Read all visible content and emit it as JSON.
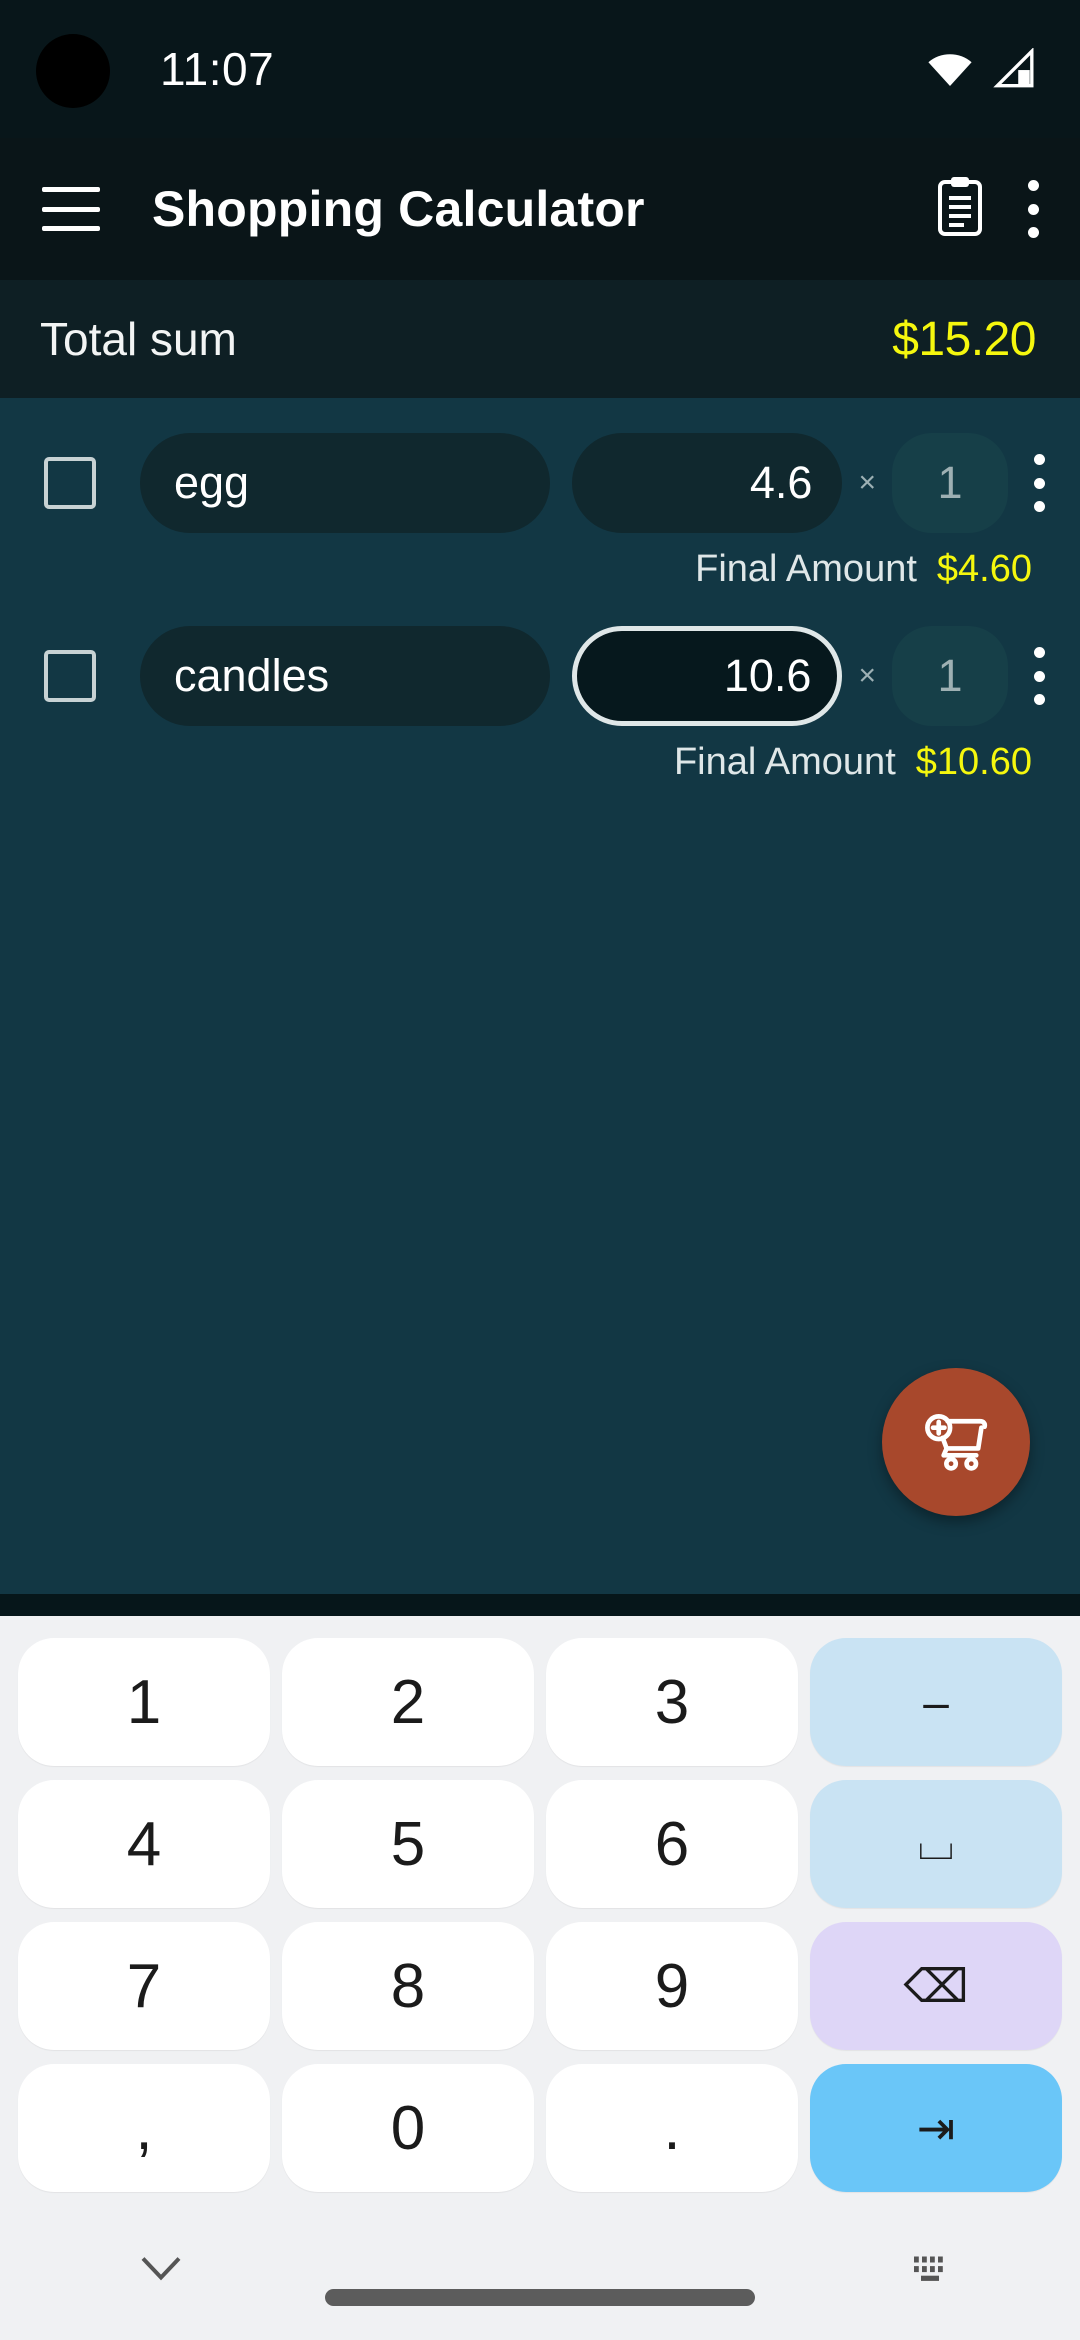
{
  "status_bar": {
    "time": "11:07",
    "wifi_icon": "wifi-icon",
    "signal_icon": "cellular-signal-icon"
  },
  "app_bar": {
    "menu_icon": "hamburger-menu-icon",
    "title": "Shopping Calculator",
    "list_icon": "clipboard-list-icon",
    "overflow_icon": "more-vertical-icon"
  },
  "total": {
    "label": "Total sum",
    "value": "$15.20",
    "value_color": "#f5f70e"
  },
  "items": [
    {
      "checked": false,
      "name": "egg",
      "price": "4.6",
      "multiply_symbol": "×",
      "quantity": "1",
      "final_label": "Final Amount",
      "final_value": "$4.60",
      "focused": false
    },
    {
      "checked": false,
      "name": "candles",
      "price": "10.6",
      "multiply_symbol": "×",
      "quantity": "1",
      "final_label": "Final Amount",
      "final_value": "$10.60",
      "focused": true
    }
  ],
  "fab": {
    "icon": "add-to-cart-icon",
    "color": "#a8482c"
  },
  "keyboard": {
    "rows": [
      [
        {
          "label": "1",
          "kind": "digit"
        },
        {
          "label": "2",
          "kind": "digit"
        },
        {
          "label": "3",
          "kind": "digit"
        },
        {
          "label": "–",
          "kind": "fn-blue",
          "name": "minus-key"
        }
      ],
      [
        {
          "label": "4",
          "kind": "digit"
        },
        {
          "label": "5",
          "kind": "digit"
        },
        {
          "label": "6",
          "kind": "digit"
        },
        {
          "label": "⌴",
          "kind": "fn-blue",
          "name": "space-key"
        }
      ],
      [
        {
          "label": "7",
          "kind": "digit"
        },
        {
          "label": "8",
          "kind": "digit"
        },
        {
          "label": "9",
          "kind": "digit"
        },
        {
          "label": "⌫",
          "kind": "fn-lilac",
          "name": "backspace-key"
        }
      ],
      [
        {
          "label": ",",
          "kind": "digit"
        },
        {
          "label": "0",
          "kind": "digit"
        },
        {
          "label": ".",
          "kind": "digit"
        },
        {
          "label": "⇥",
          "kind": "fn-enter",
          "name": "next-field-key"
        }
      ]
    ]
  },
  "nav_bar": {
    "hide_keyboard_icon": "chevron-down-icon",
    "switch_keyboard_icon": "keyboard-switch-icon",
    "home_indicator": "home-indicator"
  }
}
